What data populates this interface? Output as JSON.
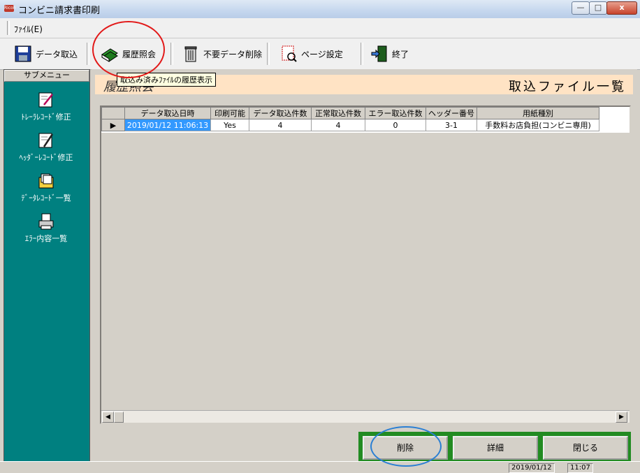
{
  "window": {
    "title": "コンビニ請求書印刷",
    "icon_text": "Ricoh"
  },
  "menu": {
    "file": "ﾌｧｲﾙ(E)"
  },
  "toolbar": {
    "import": "データ取込",
    "history": "履歴照会",
    "delete_unneeded": "不要データ削除",
    "page_setup": "ページ設定",
    "exit": "終了"
  },
  "tooltip": "取込み済みﾌｧｲﾙの履歴表示",
  "sidebar": {
    "header": "サブメニュー",
    "items": [
      {
        "label": "ﾄﾚｰﾗﾚｺｰﾄﾞ修正",
        "icon": "edit-icon"
      },
      {
        "label": "ﾍｯﾀﾞｰﾚｺｰﾄﾞ修正",
        "icon": "edit-pen-icon"
      },
      {
        "label": "ﾃﾞｰﾀﾚｺｰﾄﾞ一覧",
        "icon": "folder-docs-icon"
      },
      {
        "label": "ｴﾗｰ内容一覧",
        "icon": "printer-icon"
      }
    ]
  },
  "header": {
    "subtitle": "履歴照会",
    "title": "取込ファイル一覧"
  },
  "grid": {
    "columns": [
      "データ取込日時",
      "印刷可能",
      "データ取込件数",
      "正常取込件数",
      "エラー取込件数",
      "ヘッダー番号",
      "用紙種別"
    ],
    "rows": [
      [
        "2019/01/12 11:06:13",
        "Yes",
        "4",
        "4",
        "0",
        "3-1",
        "手数料お店負担(コンビニ専用)"
      ]
    ]
  },
  "buttons": {
    "delete": "削除",
    "detail": "詳細",
    "close": "閉じる"
  },
  "status": {
    "date": "2019/01/12",
    "time": "11:07"
  },
  "colors": {
    "sidebar": "#008080",
    "button_bar": "#228b22",
    "header_band": "#ffe3c4",
    "selection": "#3399ff"
  }
}
